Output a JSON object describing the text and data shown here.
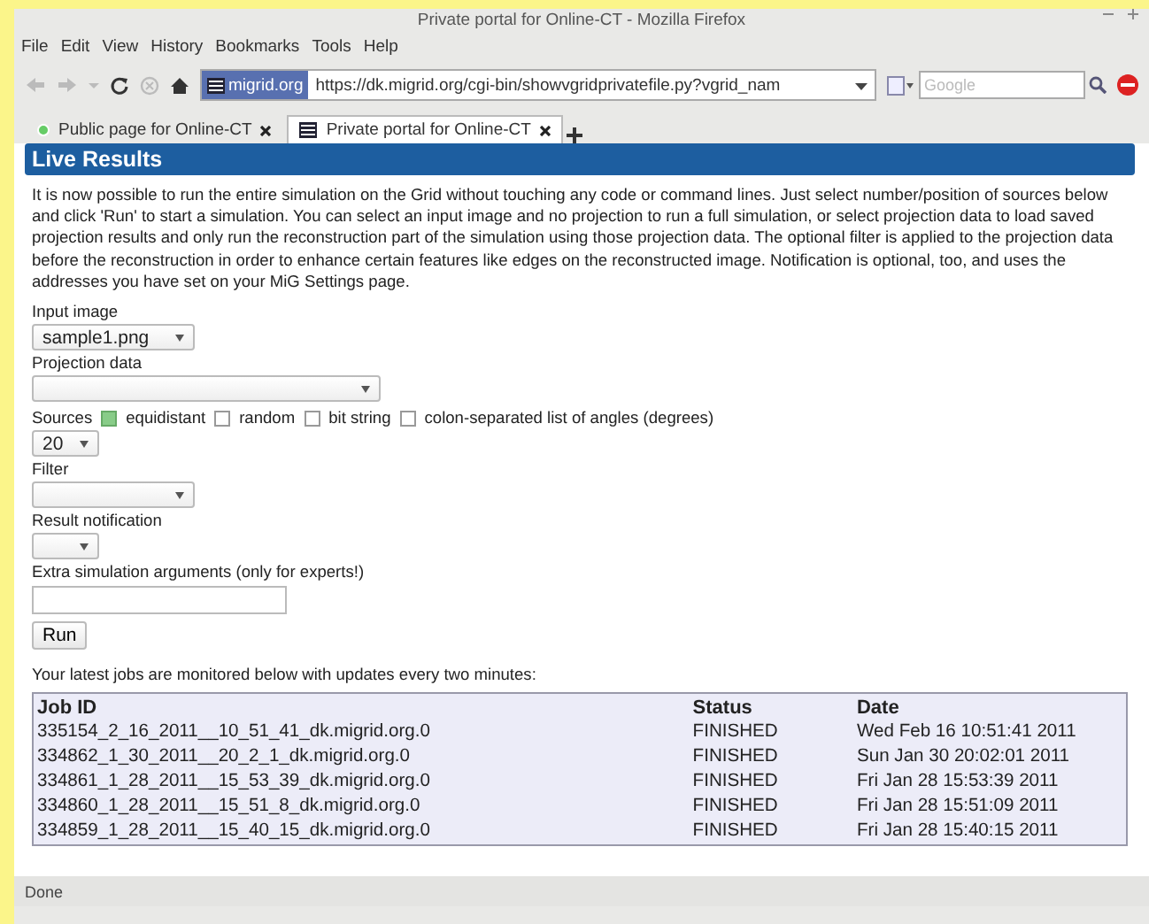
{
  "window": {
    "title": "Private portal for Online-CT - Mozilla Firefox"
  },
  "menu": [
    {
      "label": "File"
    },
    {
      "label": "Edit"
    },
    {
      "label": "View"
    },
    {
      "label": "History"
    },
    {
      "label": "Bookmarks"
    },
    {
      "label": "Tools"
    },
    {
      "label": "Help"
    }
  ],
  "toolbar": {
    "site_badge": "migrid.org",
    "url": "https://dk.migrid.org/cgi-bin/showvgridprivatefile.py?vgrid_nam",
    "search_placeholder": "Google"
  },
  "tabs": [
    {
      "label": "Public page for Online-CT",
      "selected": false
    },
    {
      "label": "Private portal for Online-CT",
      "selected": true
    }
  ],
  "page": {
    "heading": "Live Results",
    "intro": "It is now possible to run the entire simulation on the Grid without touching any code or command lines. Just select number/position of sources below and click 'Run' to start a simulation. You can select an input image and no projection to run a full simulation, or select projection data to load saved projection results and only run the reconstruction part of the simulation using those projection data. The optional filter is applied to the projection data before the reconstruction in order to enhance certain features like edges on the reconstructed image. Notification is optional, too, and uses the addresses you have set on your MiG Settings page.",
    "fields": [
      {
        "kind": "select",
        "label": "Input image",
        "value": "sample1.png"
      },
      {
        "kind": "select",
        "label": "Projection data"
      },
      {
        "kind": "radios",
        "label": "Sources",
        "options": [
          {
            "label": "equidistant",
            "selected": true
          },
          {
            "label": "random",
            "selected": false
          },
          {
            "label": "bit string",
            "selected": false
          },
          {
            "label": "colon-separated list of angles (degrees)",
            "selected": false
          }
        ]
      },
      {
        "kind": "select",
        "value": "20"
      },
      {
        "kind": "select",
        "label": "Filter"
      },
      {
        "kind": "select",
        "label": "Result notification"
      },
      {
        "kind": "text",
        "label": "Extra simulation arguments (only for experts!)"
      },
      {
        "kind": "button",
        "label": "Run"
      }
    ],
    "jobs_note": "Your latest jobs are monitored below with updates every two minutes:",
    "table": {
      "columns": [
        "Job ID",
        "Status",
        "Date"
      ],
      "rows": [
        [
          "335154_2_16_2011__10_51_41_dk.migrid.org.0",
          "FINISHED",
          "Wed Feb 16 10:51:41 2011"
        ],
        [
          "334862_1_30_2011__20_2_1_dk.migrid.org.0",
          "FINISHED",
          "Sun Jan 30 20:02:01 2011"
        ],
        [
          "334861_1_28_2011__15_53_39_dk.migrid.org.0",
          "FINISHED",
          "Fri Jan 28 15:53:39 2011"
        ],
        [
          "334860_1_28_2011__15_51_8_dk.migrid.org.0",
          "FINISHED",
          "Fri Jan 28 15:51:09 2011"
        ],
        [
          "334859_1_28_2011__15_40_15_dk.migrid.org.0",
          "FINISHED",
          "Fri Jan 28 15:40:15 2011"
        ]
      ]
    }
  },
  "status_bar": {
    "text": "Done"
  }
}
